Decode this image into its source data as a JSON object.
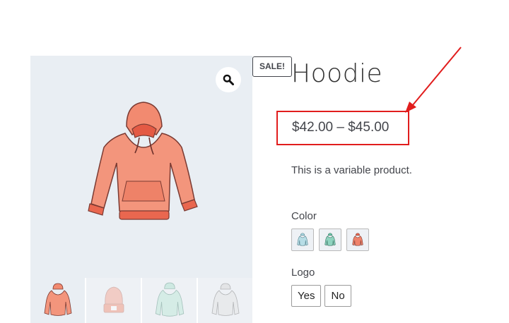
{
  "product": {
    "title": "Hoodie",
    "sale_badge": "SALE!",
    "price": "$42.00 – $45.00",
    "description": "This is a variable product."
  },
  "gallery": {
    "zoom_icon": "magnifier-icon",
    "thumbnails": [
      "hoodie-pink",
      "beanie-pink",
      "hoodie-mint",
      "hoodie-grey"
    ]
  },
  "attributes": {
    "color": {
      "label": "Color",
      "swatches": [
        {
          "name": "blue",
          "color": "#a9d6e0"
        },
        {
          "name": "green",
          "color": "#8fd3bf"
        },
        {
          "name": "red",
          "color": "#f0826a"
        }
      ]
    },
    "logo": {
      "label": "Logo",
      "options": [
        "Yes",
        "No"
      ]
    }
  },
  "annotation": {
    "highlight_color": "#e11d1d"
  }
}
